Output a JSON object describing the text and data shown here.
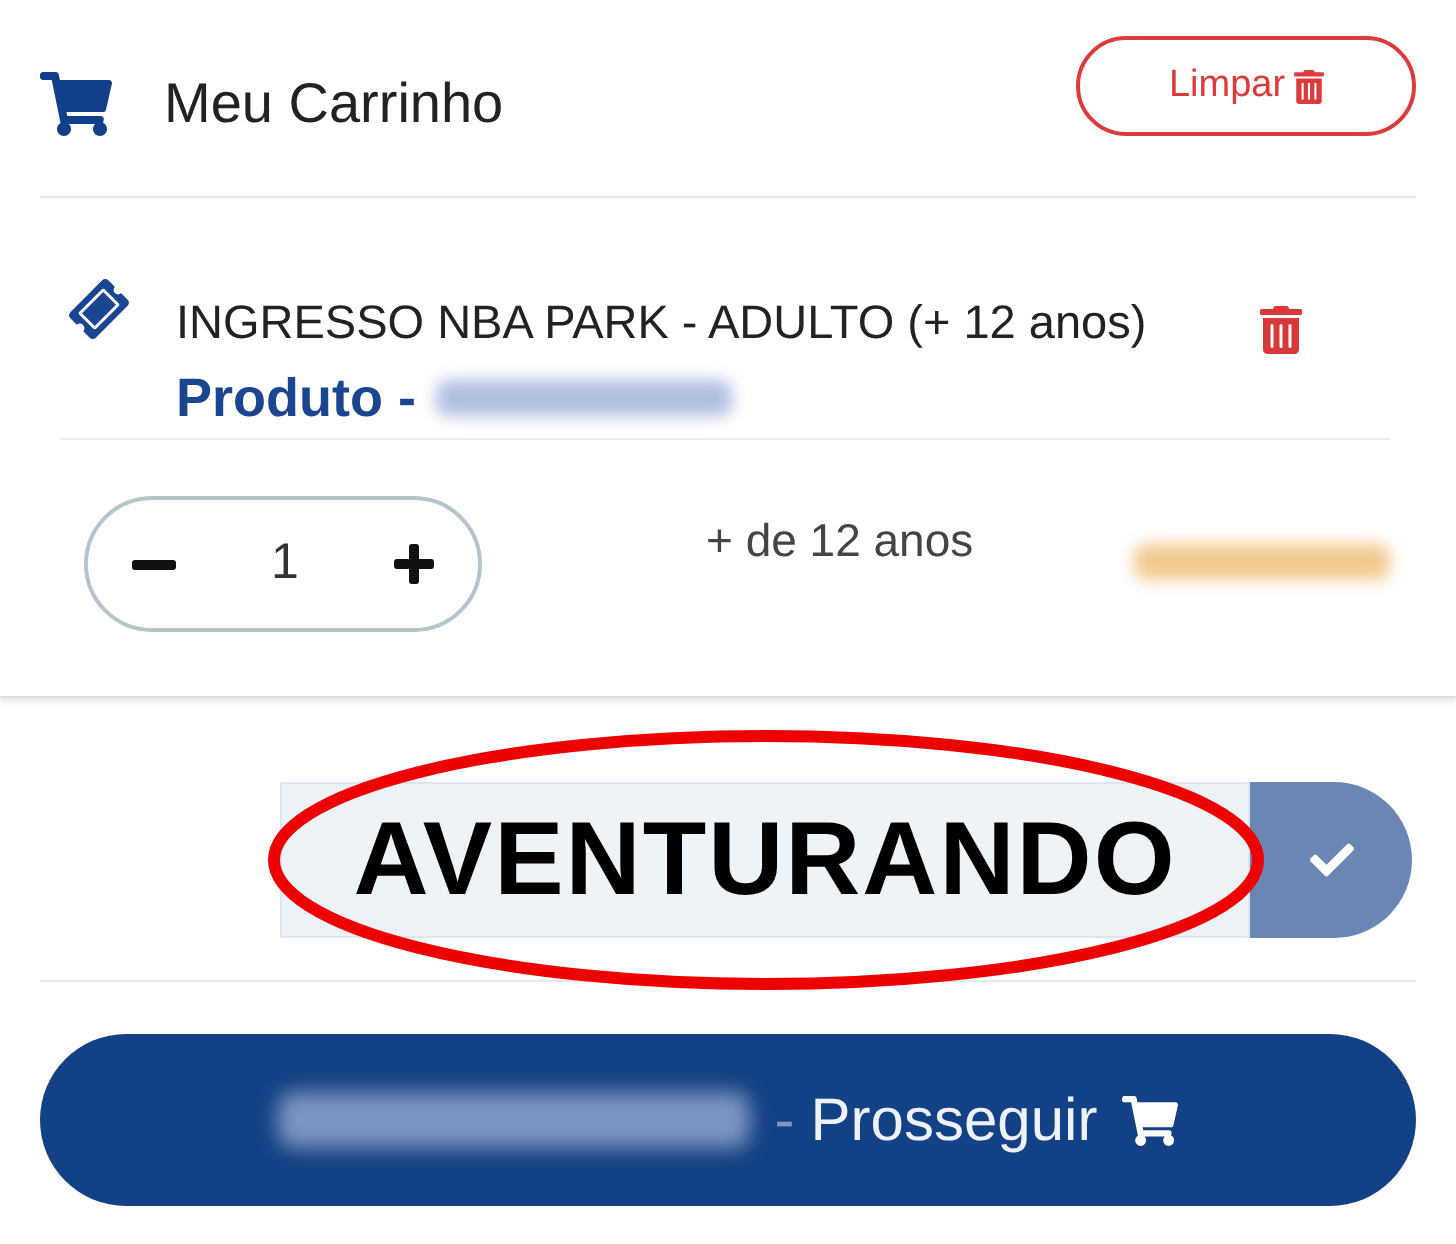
{
  "header": {
    "title": "Meu Carrinho",
    "clear_button": {
      "label": "Limpar"
    }
  },
  "cart_items": [
    {
      "name": "INGRESSO NBA PARK - ADULTO (+ 12 anos)",
      "category": "Produto -",
      "date_blurred": true,
      "quantity": "1",
      "age_note": "+ de 12 anos",
      "price_blurred": true
    }
  ],
  "coupon": {
    "value": "AVENTURANDO",
    "circled": true
  },
  "checkout_button": {
    "total_blurred": true,
    "separator": "-",
    "label": "Prosseguir"
  }
}
